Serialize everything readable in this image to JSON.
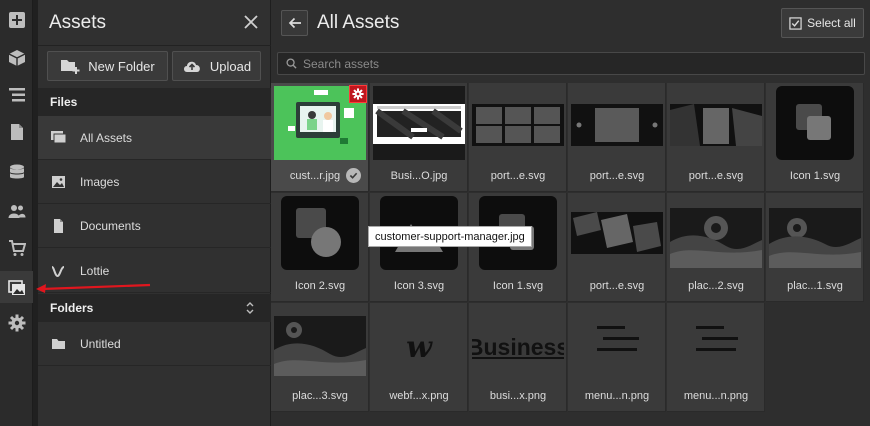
{
  "rail": {
    "items": [
      {
        "icon": "add-icon"
      },
      {
        "icon": "box-icon"
      },
      {
        "icon": "navigator-icon"
      },
      {
        "icon": "pages-icon"
      },
      {
        "icon": "cms-icon"
      },
      {
        "icon": "users-icon"
      },
      {
        "icon": "ecommerce-icon"
      },
      {
        "icon": "assets-icon"
      },
      {
        "icon": "settings-icon"
      }
    ]
  },
  "panel": {
    "title": "Assets",
    "new_folder_label": "New Folder",
    "upload_label": "Upload",
    "files_heading": "Files",
    "files": [
      {
        "label": "All Assets",
        "icon": "all-assets-icon"
      },
      {
        "label": "Images",
        "icon": "image-icon"
      },
      {
        "label": "Documents",
        "icon": "document-icon"
      },
      {
        "label": "Lottie",
        "icon": "lottie-icon"
      }
    ],
    "folders_heading": "Folders",
    "folders": [
      {
        "label": "Untitled",
        "icon": "folder-icon"
      }
    ]
  },
  "main": {
    "title": "All Assets",
    "select_all_label": "Select all",
    "search_placeholder": "Search assets",
    "tooltip": "customer-support-manager.jpg",
    "assets": [
      {
        "label": "cust...r.jpg"
      },
      {
        "label": "Busi...O.jpg"
      },
      {
        "label": "port...e.svg"
      },
      {
        "label": "port...e.svg"
      },
      {
        "label": "port...e.svg"
      },
      {
        "label": "Icon 1.svg"
      },
      {
        "label": "Icon 2.svg"
      },
      {
        "label": "Icon 3.svg"
      },
      {
        "label": "Icon 1.svg"
      },
      {
        "label": "port...e.svg"
      },
      {
        "label": "plac...2.svg"
      },
      {
        "label": "plac...1.svg"
      },
      {
        "label": "plac...3.svg"
      },
      {
        "label": "webf...x.png"
      },
      {
        "label": "busi...x.png"
      },
      {
        "label": "menu...n.png"
      },
      {
        "label": "menu...n.png"
      }
    ],
    "thumb_text": {
      "webflow_logo": "w",
      "business_logo": "Business"
    }
  },
  "colors": {
    "highlight_red": "#e0161e",
    "thumb_green": "#4cc35a"
  }
}
